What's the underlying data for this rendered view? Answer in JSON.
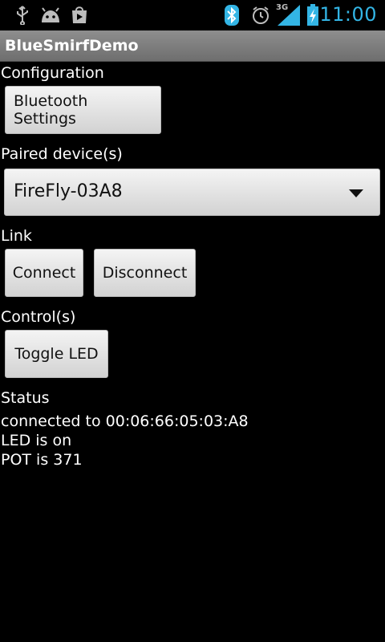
{
  "status_bar": {
    "time": "11:00",
    "network": "3G",
    "icons": [
      "usb-icon",
      "android-icon",
      "play-store-icon",
      "bluetooth-icon",
      "alarm-icon",
      "signal-icon",
      "battery-charging-icon"
    ],
    "accent": "#33b5e5"
  },
  "app": {
    "title": "BlueSmirfDemo"
  },
  "configuration": {
    "label": "Configuration",
    "bluetooth_settings_button": "Bluetooth Settings"
  },
  "paired": {
    "label": "Paired device(s)",
    "selected_device": "FireFly-03A8"
  },
  "link": {
    "label": "Link",
    "connect_button": "Connect",
    "disconnect_button": "Disconnect"
  },
  "controls": {
    "label": "Control(s)",
    "toggle_led_button": "Toggle LED"
  },
  "status": {
    "label": "Status",
    "lines": [
      "connected to 00:06:66:05:03:A8",
      "LED is on",
      "POT is 371"
    ]
  }
}
